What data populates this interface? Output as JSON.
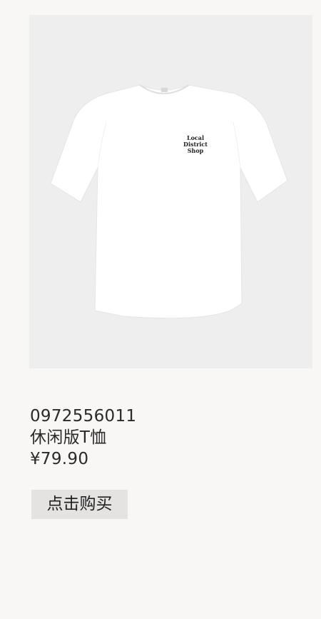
{
  "product": {
    "image_label_line1": "Local",
    "image_label_line2": "District",
    "image_label_line3": "Shop",
    "article_number": "0972556011",
    "name": "休闲版T恤",
    "price": "¥79.90"
  },
  "actions": {
    "buy_label": "点击购买"
  },
  "colors": {
    "background": "#f8f7f5",
    "image_background": "#efeeee",
    "button_background": "#e4e3e2",
    "text": "#222222"
  }
}
